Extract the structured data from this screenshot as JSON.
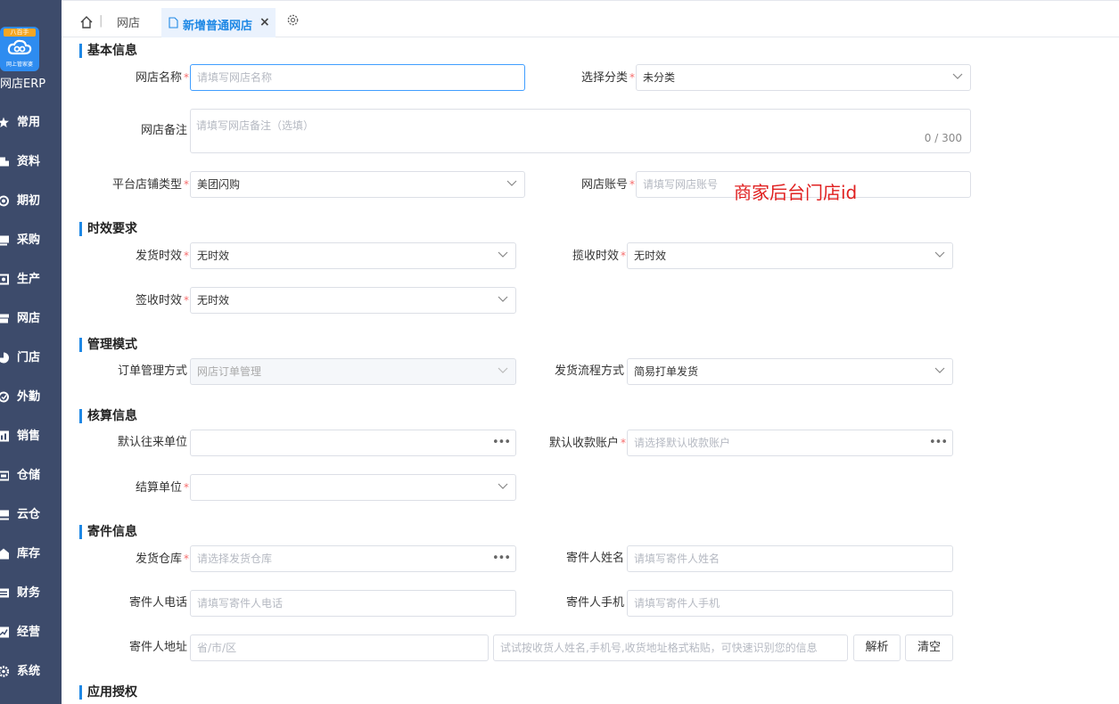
{
  "sidebar": {
    "logo_top": "八百手",
    "logo_sub": "网上管家婆",
    "brand": "网店ERP",
    "items": [
      {
        "label": "常用"
      },
      {
        "label": "资料"
      },
      {
        "label": "期初"
      },
      {
        "label": "采购"
      },
      {
        "label": "生产"
      },
      {
        "label": "网店"
      },
      {
        "label": "门店"
      },
      {
        "label": "外勤"
      },
      {
        "label": "销售"
      },
      {
        "label": "仓储"
      },
      {
        "label": "云仓"
      },
      {
        "label": "库存"
      },
      {
        "label": "财务"
      },
      {
        "label": "经营"
      },
      {
        "label": "系统"
      }
    ]
  },
  "tabs": {
    "separator": "|",
    "shop": "网店",
    "active": "新增普通网店",
    "close": "×"
  },
  "sections": {
    "basic": "基本信息",
    "timeliness": "时效要求",
    "management": "管理模式",
    "accounting": "核算信息",
    "sender": "寄件信息",
    "auth": "应用授权"
  },
  "form": {
    "shop_name": {
      "label": "网店名称",
      "placeholder": "请填写网店名称"
    },
    "category": {
      "label": "选择分类",
      "value": "未分类"
    },
    "remark": {
      "label": "网店备注",
      "placeholder": "请填写网店备注（选填）",
      "count": "0 / 300"
    },
    "platform_type": {
      "label": "平台店铺类型",
      "value": "美团闪购"
    },
    "shop_account": {
      "label": "网店账号",
      "placeholder": "请填写网店账号"
    },
    "ship_time": {
      "label": "发货时效",
      "value": "无时效"
    },
    "pickup_time": {
      "label": "揽收时效",
      "value": "无时效"
    },
    "sign_time": {
      "label": "签收时效",
      "value": "无时效"
    },
    "order_mgmt": {
      "label": "订单管理方式",
      "value": "网店订单管理"
    },
    "ship_flow": {
      "label": "发货流程方式",
      "value": "简易打单发货"
    },
    "default_partner": {
      "label": "默认往来单位",
      "value": ""
    },
    "default_account": {
      "label": "默认收款账户",
      "placeholder": "请选择默认收款账户"
    },
    "settle_unit": {
      "label": "结算单位",
      "value": ""
    },
    "warehouse": {
      "label": "发货仓库",
      "placeholder": "请选择发货仓库"
    },
    "sender_name": {
      "label": "寄件人姓名",
      "placeholder": "请填写寄件人姓名"
    },
    "sender_phone": {
      "label": "寄件人电话",
      "placeholder": "请填写寄件人电话"
    },
    "sender_mobile": {
      "label": "寄件人手机",
      "placeholder": "请填写寄件人手机"
    },
    "sender_address": {
      "label": "寄件人地址",
      "placeholder": "省/市/区"
    },
    "smart_paste": {
      "placeholder": "试试按收货人姓名,手机号,收货地址格式粘贴，可快速识别您的信息"
    },
    "parse_button": "解析",
    "clear_button": "清空"
  },
  "annotation": "商家后台门店id",
  "required_mark": "*",
  "dots": "•••",
  "colors": {
    "sidebar": "#3d4b6b",
    "accent": "#1e88e5",
    "required": "#f56c6c",
    "annotation": "#e02020"
  }
}
